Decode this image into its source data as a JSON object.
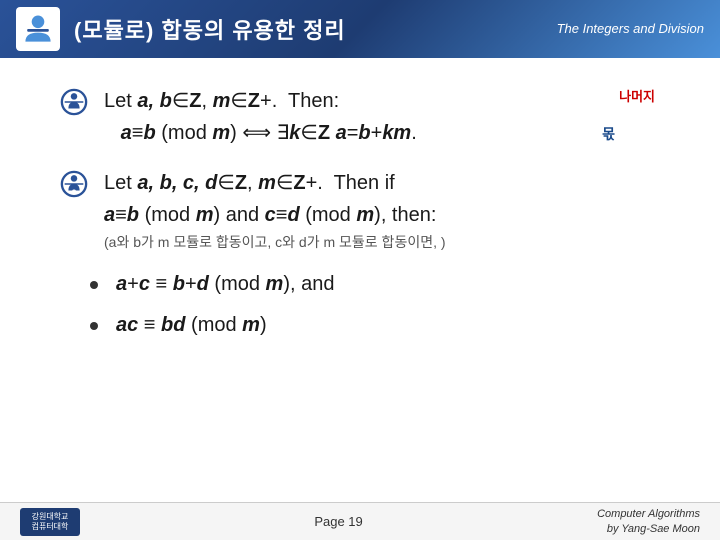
{
  "header": {
    "title": "(모듈로) 합동의 유용한 정리",
    "subtitle_line1": "The Integers and Division"
  },
  "annotations": {
    "namuji": "나머지",
    "mot": "몫"
  },
  "bullet1": {
    "line1": "Let a, b∈Z, m∈Z+.  Then:",
    "line2": "a≡b (mod m) ⟺ ∃k∈Z a=b+km."
  },
  "bullet2": {
    "line1": "Let a, b, c, d∈Z, m∈Z+.  Then if",
    "line2": "a≡b (mod m) and c≡d (mod m), then:",
    "subtext": "(a와 b가 m 모듈로 합동이고, c와 d가 m 모듈로 합동이면, )"
  },
  "subbullets": [
    {
      "text": "a+c ≡ b+d (mod m), and"
    },
    {
      "text": "ac ≡ bd (mod m)"
    }
  ],
  "footer": {
    "page_label": "Page 19",
    "author_line1": "Computer Algorithms",
    "author_line2": "by Yang-Sae Moon",
    "university_line1": "강원대학교",
    "university_line2": "컴퓨터대학"
  }
}
